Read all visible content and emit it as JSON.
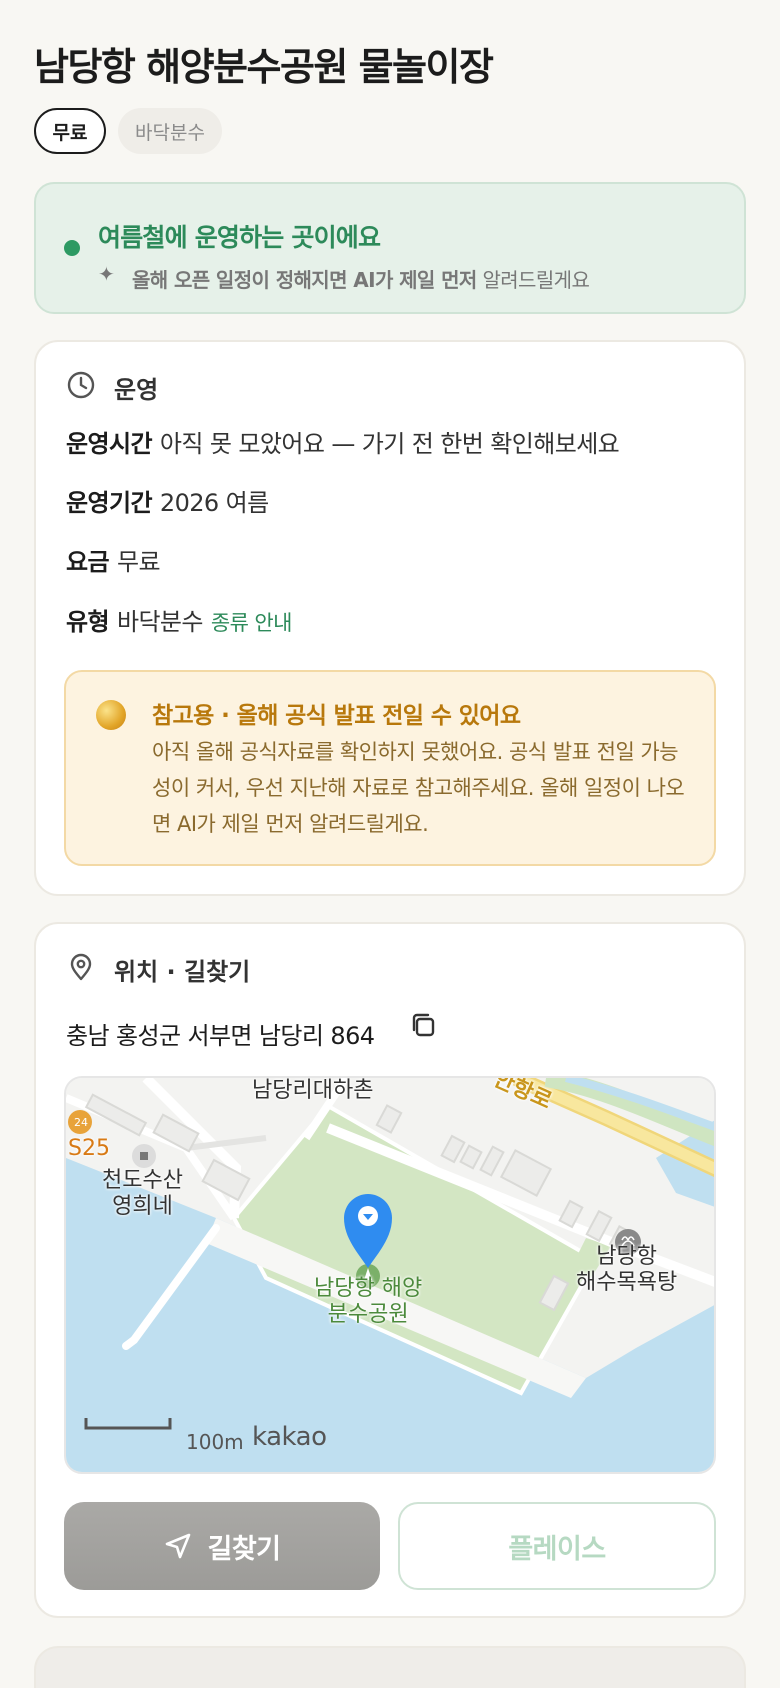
{
  "place": {
    "title": "남당항 해양분수공원 물놀이장",
    "tags": [
      "무료",
      "바닥분수"
    ]
  },
  "notice": {
    "title": "여름철에 운영하는 곳이에요",
    "spark_icon": "sparkle-icon",
    "subtitle_bold": "올해 오픈 일정이 정해지면 AI가 제일 먼저",
    "subtitle_rest": " 알려드릴게요",
    "accent": "#2d8a5a"
  },
  "operation": {
    "section_title": "운영",
    "section_icon": "clock-icon",
    "rows": [
      {
        "key": "운영시간",
        "value": "아직 못 모았어요 — 가기 전 한번 확인해보세요"
      },
      {
        "key": "운영기간",
        "value": "2026 여름"
      },
      {
        "key": "요금",
        "value": "무료"
      },
      {
        "key": "유형",
        "value": "바닥분수",
        "link": "종류 안내"
      }
    ],
    "warning": {
      "title": "참고용 · 올해 공식 발표 전일 수 있어요",
      "body": "아직 올해 공식자료를 확인하지 못했어요. 공식 발표 전일 가능성이 커서, 우선 지난해 자료로 참고해주세요. 올해 일정이 나오면 AI가 제일 먼저 알려드릴게요.",
      "accent": "#b8780c"
    }
  },
  "location": {
    "section_title": "위치 · 길찾기",
    "section_icon": "map-pin-icon",
    "address": "충남 홍성군 서부면 남당리 864",
    "copy_icon": "copy-icon",
    "map": {
      "labels": {
        "village": "남당리대하촌",
        "road": "안항로",
        "badge": "24",
        "station": "S25",
        "restaurant_line1": "천도수산",
        "restaurant_line2": "영희네",
        "park_line1": "남당항 해양",
        "park_line2": "분수공원",
        "bath_line1": "남당항",
        "bath_line2": "해수목욕탕"
      },
      "scale": "100m",
      "provider": "kakao"
    },
    "buttons": {
      "directions": "길찾기",
      "directions_icon": "navigation-arrow-icon",
      "places": "플레이스"
    }
  }
}
